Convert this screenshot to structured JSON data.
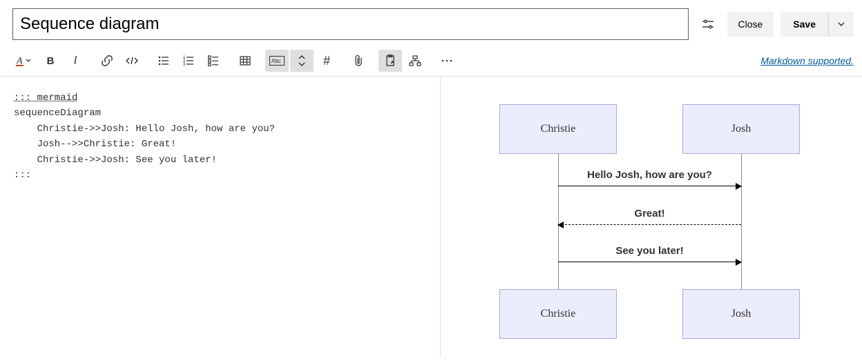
{
  "header": {
    "title_value": "Sequence diagram",
    "close_label": "Close",
    "save_label": "Save"
  },
  "toolbar": {
    "markdown_link": "Markdown supported."
  },
  "editor": {
    "line1": "::: mermaid",
    "line2": "sequenceDiagram",
    "line3": "    Christie->>Josh: Hello Josh, how are you?",
    "line4": "    Josh-->>Christie: Great!",
    "line5": "    Christie->>Josh: See you later!",
    "line6": ":::"
  },
  "diagram": {
    "participant1": "Christie",
    "participant2": "Josh",
    "msg1": "Hello Josh, how are you?",
    "msg2": "Great!",
    "msg3": "See you later!"
  },
  "chart_data": {
    "type": "sequence",
    "participants": [
      "Christie",
      "Josh"
    ],
    "messages": [
      {
        "from": "Christie",
        "to": "Josh",
        "text": "Hello Josh, how are you?",
        "style": "solid"
      },
      {
        "from": "Josh",
        "to": "Christie",
        "text": "Great!",
        "style": "dashed"
      },
      {
        "from": "Christie",
        "to": "Josh",
        "text": "See you later!",
        "style": "solid"
      }
    ]
  }
}
